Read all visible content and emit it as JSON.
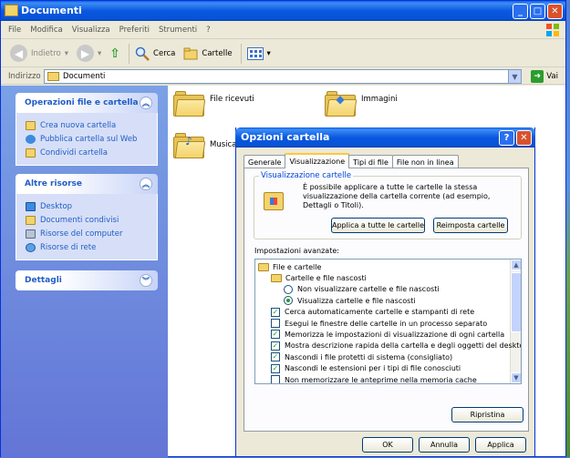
{
  "explorer": {
    "title": "Documenti",
    "menu": [
      "File",
      "Modifica",
      "Visualizza",
      "Preferiti",
      "Strumenti",
      "?"
    ],
    "toolbar": {
      "back": "Indietro",
      "search": "Cerca",
      "folders": "Cartelle"
    },
    "address": {
      "label": "Indirizzo",
      "value": "Documenti",
      "go": "Vai"
    },
    "tasks": {
      "file_ops": {
        "title": "Operazioni file e cartella",
        "items": [
          "Crea nuova cartella",
          "Pubblica cartella sul Web",
          "Condividi cartella"
        ]
      },
      "other": {
        "title": "Altre risorse",
        "items": [
          "Desktop",
          "Documenti condivisi",
          "Risorse del computer",
          "Risorse di rete"
        ]
      },
      "details": {
        "title": "Dettagli"
      }
    },
    "files": [
      "File ricevuti",
      "Immagini",
      "Musica"
    ]
  },
  "dialog": {
    "title": "Opzioni cartella",
    "help": "?",
    "tabs": [
      "Generale",
      "Visualizzazione",
      "Tipi di file",
      "File non in linea"
    ],
    "group": {
      "title": "Visualizzazione cartelle",
      "text": "È possibile applicare a tutte le cartelle la stessa visualizzazione della cartella corrente (ad esempio, Dettagli o Titoli).",
      "apply_all": "Applica a tutte le cartelle",
      "reset_all": "Reimposta cartelle"
    },
    "advanced_label": "Impostazioni avanzate:",
    "tree": [
      {
        "kind": "folder",
        "indent": 0,
        "label": "File e cartelle"
      },
      {
        "kind": "folder",
        "indent": 1,
        "label": "Cartelle e file nascosti"
      },
      {
        "kind": "radio",
        "indent": 2,
        "checked": false,
        "label": "Non visualizzare cartelle e file nascosti"
      },
      {
        "kind": "radio",
        "indent": 2,
        "checked": true,
        "label": "Visualizza cartelle e file nascosti"
      },
      {
        "kind": "check",
        "indent": 1,
        "checked": true,
        "label": "Cerca automaticamente cartelle e stampanti di rete"
      },
      {
        "kind": "check",
        "indent": 1,
        "checked": false,
        "label": "Esegui le finestre delle cartelle in un processo separato"
      },
      {
        "kind": "check",
        "indent": 1,
        "checked": true,
        "label": "Memorizza le impostazioni di visualizzazione di ogni cartella"
      },
      {
        "kind": "check",
        "indent": 1,
        "checked": true,
        "label": "Mostra descrizione rapida della cartella e degli oggetti del desktop"
      },
      {
        "kind": "check",
        "indent": 1,
        "checked": true,
        "label": "Nascondi i file protetti di sistema (consigliato)"
      },
      {
        "kind": "check",
        "indent": 1,
        "checked": true,
        "label": "Nascondi le estensioni per i tipi di file conosciuti"
      },
      {
        "kind": "check",
        "indent": 1,
        "checked": false,
        "label": "Non memorizzare le anteprime nella memoria cache"
      }
    ],
    "restore": "Ripristina",
    "ok": "OK",
    "cancel": "Annulla",
    "apply": "Applica"
  }
}
